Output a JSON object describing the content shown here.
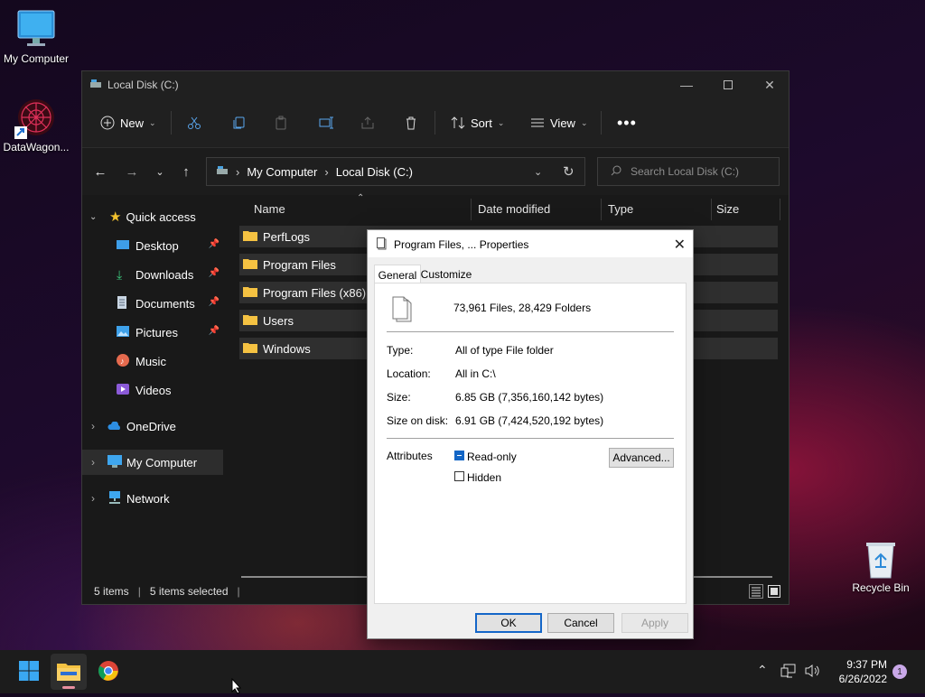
{
  "desktop": {
    "icons": [
      {
        "label": "My Computer"
      },
      {
        "label": "DataWagon..."
      },
      {
        "label": "Recycle Bin"
      }
    ]
  },
  "explorer": {
    "title": "Local Disk (C:)",
    "toolbar": {
      "new_label": "New",
      "sort_label": "Sort",
      "view_label": "View"
    },
    "address": {
      "crumbs": [
        "My Computer",
        "Local Disk (C:)"
      ],
      "search_placeholder": "Search Local Disk (C:)"
    },
    "sidebar": {
      "quick_access": "Quick access",
      "items": [
        {
          "label": "Desktop"
        },
        {
          "label": "Downloads"
        },
        {
          "label": "Documents"
        },
        {
          "label": "Pictures"
        },
        {
          "label": "Music"
        },
        {
          "label": "Videos"
        },
        {
          "label": "OneDrive"
        },
        {
          "label": "My Computer"
        },
        {
          "label": "Network"
        }
      ]
    },
    "columns": [
      "Name",
      "Date modified",
      "Type",
      "Size"
    ],
    "files": [
      {
        "name": "PerfLogs"
      },
      {
        "name": "Program Files"
      },
      {
        "name": "Program Files (x86)"
      },
      {
        "name": "Users"
      },
      {
        "name": "Windows"
      }
    ],
    "status": {
      "items": "5 items",
      "selected": "5 items selected"
    }
  },
  "dialog": {
    "title": "Program Files, ... Properties",
    "tabs": [
      "General",
      "Customize"
    ],
    "summary": "73,961 Files, 28,429 Folders",
    "type_label": "Type:",
    "type_value": "All of type File folder",
    "location_label": "Location:",
    "location_value": "All in C:\\",
    "size_label": "Size:",
    "size_value": "6.85 GB (7,356,160,142 bytes)",
    "sod_label": "Size on disk:",
    "sod_value": "6.91 GB (7,424,520,192 bytes)",
    "attributes_label": "Attributes",
    "readonly_label": "Read-only",
    "hidden_label": "Hidden",
    "advanced_label": "Advanced...",
    "ok_label": "OK",
    "cancel_label": "Cancel",
    "apply_label": "Apply"
  },
  "taskbar": {
    "time": "9:37 PM",
    "date": "6/26/2022",
    "notification_count": "1"
  }
}
